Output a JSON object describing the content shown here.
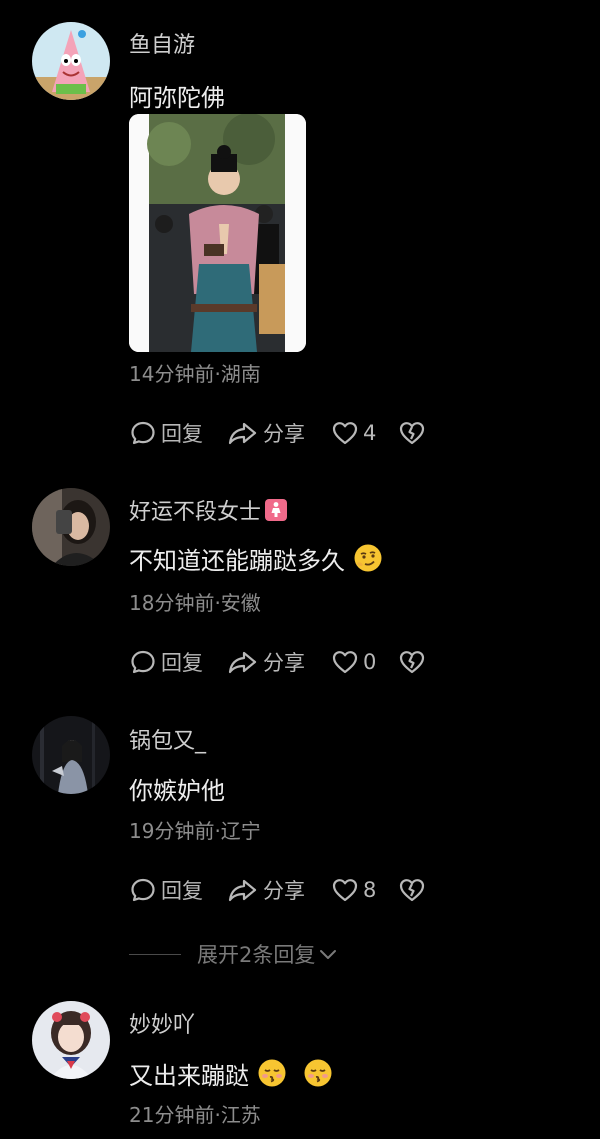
{
  "comments": [
    {
      "username": "鱼自游",
      "text": "阿弥陀佛",
      "meta": "14分钟前·湖南",
      "reply_label": "回复",
      "share_label": "分享",
      "like_count": "4"
    },
    {
      "username": "好运不段女士",
      "text": "不知道还能蹦跶多久",
      "meta": "18分钟前·安徽",
      "reply_label": "回复",
      "share_label": "分享",
      "like_count": "0"
    },
    {
      "username": "锅包又_",
      "text": "你嫉妒他",
      "meta": "19分钟前·辽宁",
      "reply_label": "回复",
      "share_label": "分享",
      "like_count": "8"
    },
    {
      "username": "妙妙吖",
      "text": "又出来蹦跶",
      "meta": "21分钟前·江苏"
    }
  ],
  "expand_label": "展开2条回复",
  "colors": {
    "background": "#000000",
    "username": "#cfcfcf",
    "meta": "#8d8d8d",
    "action": "#b8b8b8",
    "badge": "#f06a8a"
  },
  "icons": [
    "reply-icon",
    "share-icon",
    "heart-icon",
    "broken-heart-icon",
    "chevron-down-icon",
    "smirk-emoji-icon",
    "kiss-emoji-icon",
    "female-badge-icon"
  ]
}
